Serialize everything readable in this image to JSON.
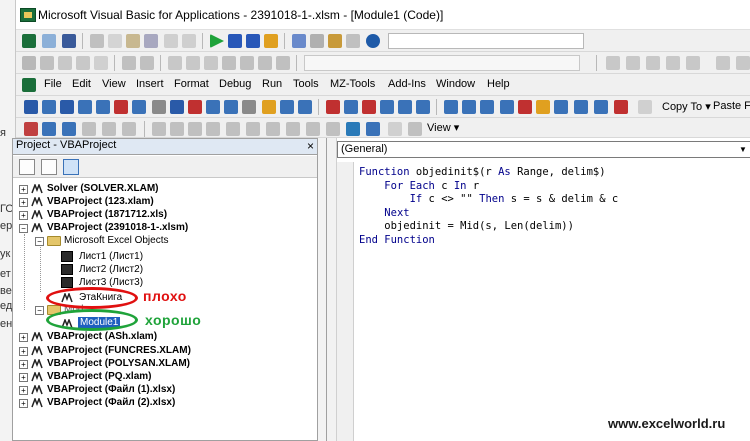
{
  "window": {
    "title": "Microsoft Visual Basic for Applications - 2391018-1-.xlsm - [Module1 (Code)]"
  },
  "left_strip": [
    "я",
    "ГО",
    "ер",
    "ук",
    "ет",
    "ве",
    "ед",
    "ен"
  ],
  "menu": {
    "items": [
      "File",
      "Edit",
      "View",
      "Insert",
      "Format",
      "Debug",
      "Run",
      "Tools",
      "MZ-Tools",
      "Add-Ins",
      "Window",
      "Help"
    ]
  },
  "toolbar": {
    "copy_to_label": "Copy To",
    "paste_from_label": "Paste Fr",
    "view_label": "View"
  },
  "project": {
    "title": "Project - VBAProject",
    "close": "×",
    "tree": {
      "n0": "Solver (SOLVER.XLAM)",
      "n1": "VBAProject (123.xlam)",
      "n2": "VBAProject (1871712.xls)",
      "n3": "VBAProject (2391018-1-.xlsm)",
      "n4": "Microsoft Excel Objects",
      "n5": "Лист1 (Лист1)",
      "n6": "Лист2 (Лист2)",
      "n7": "Лист3 (Лист3)",
      "n8": "ЭтаКнига",
      "n9": "Mod",
      "n10": "Module1",
      "n11": "VBAProject (ASh.xlam)",
      "n12": "VBAProject (FUNCRES.XLAM)",
      "n13": "VBAProject (POLYSAN.XLAM)",
      "n14": "VBAProject (PQ.xlam)",
      "n15": "VBAProject (Файл (1).xlsx)",
      "n16": "VBAProject (Файл (2).xlsx)"
    }
  },
  "code": {
    "object_dropdown": "(General)",
    "lines": [
      [
        {
          "t": "Function",
          "k": true
        },
        {
          "t": " objedinit$(r "
        },
        {
          "t": "As",
          "k": true
        },
        {
          "t": " Range, delim$)"
        }
      ],
      [
        {
          "t": "    "
        },
        {
          "t": "For Each",
          "k": true
        },
        {
          "t": " c "
        },
        {
          "t": "In",
          "k": true
        },
        {
          "t": " r"
        }
      ],
      [
        {
          "t": "        "
        },
        {
          "t": "If",
          "k": true
        },
        {
          "t": " c <> \"\" "
        },
        {
          "t": "Then",
          "k": true
        },
        {
          "t": " s = s & delim & c"
        }
      ],
      [
        {
          "t": "    "
        },
        {
          "t": "Next",
          "k": true
        }
      ],
      [
        {
          "t": "    objedinit = Mid(s, Len(delim))"
        }
      ],
      [
        {
          "t": "End Function",
          "k": true
        }
      ]
    ]
  },
  "annotations": {
    "bad": "плохо",
    "good": "хорошо"
  },
  "watermark": "www.excelworld.ru"
}
